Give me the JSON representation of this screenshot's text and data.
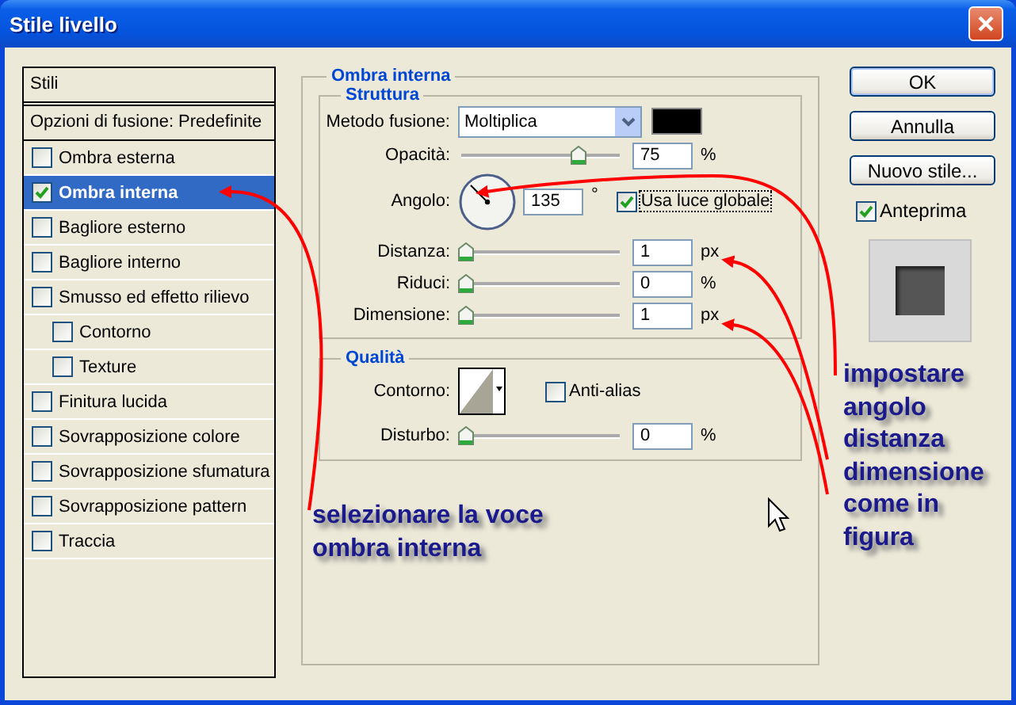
{
  "window": {
    "title": "Stile livello"
  },
  "styles_list": {
    "header": "Stili",
    "blend_options": "Opzioni di fusione: Predefinite",
    "items": [
      {
        "label": "Ombra esterna",
        "checked": false,
        "selected": false
      },
      {
        "label": "Ombra interna",
        "checked": true,
        "selected": true
      },
      {
        "label": "Bagliore esterno",
        "checked": false,
        "selected": false
      },
      {
        "label": "Bagliore interno",
        "checked": false,
        "selected": false
      },
      {
        "label": "Smusso ed effetto rilievo",
        "checked": false,
        "selected": false,
        "children": [
          {
            "label": "Contorno",
            "checked": false,
            "selected": false
          },
          {
            "label": "Texture",
            "checked": false,
            "selected": false
          }
        ]
      },
      {
        "label": "Finitura lucida",
        "checked": false,
        "selected": false
      },
      {
        "label": "Sovrapposizione colore",
        "checked": false,
        "selected": false
      },
      {
        "label": "Sovrapposizione sfumatura",
        "checked": false,
        "selected": false
      },
      {
        "label": "Sovrapposizione pattern",
        "checked": false,
        "selected": false
      },
      {
        "label": "Traccia",
        "checked": false,
        "selected": false
      }
    ]
  },
  "settings": {
    "title": "Ombra interna",
    "structure": {
      "title": "Struttura",
      "blend_mode": {
        "label": "Metodo fusione:",
        "value": "Moltiplica",
        "color": "#000000"
      },
      "opacity": {
        "label": "Opacità:",
        "level": 0.75,
        "value": "75",
        "unit": "%"
      },
      "angle": {
        "label": "Angolo:",
        "value": "135",
        "unit": "°",
        "global_light": {
          "label": "Usa luce globale",
          "checked": true
        }
      },
      "sliders": [
        {
          "label": "Distanza:",
          "level": 0,
          "value": "1",
          "unit": "px"
        },
        {
          "label": "Riduci:",
          "level": 0,
          "value": "0",
          "unit": "%"
        },
        {
          "label": "Dimensione:",
          "level": 0,
          "value": "1",
          "unit": "px"
        }
      ]
    },
    "quality": {
      "title": "Qualità",
      "contour": {
        "label": "Contorno:"
      },
      "anti_alias": {
        "label": "Anti-alias",
        "checked": false
      },
      "noise": {
        "label": "Disturbo:",
        "level": 0,
        "value": "0",
        "unit": "%"
      }
    }
  },
  "buttons": [
    {
      "label": "OK",
      "default": true
    },
    {
      "label": "Annulla",
      "default": false
    },
    {
      "label": "Nuovo stile...",
      "default": false
    }
  ],
  "preview": {
    "label": "Anteprima",
    "checked": true
  },
  "annotations": [
    {
      "text": "selezionare la voce ombra interna",
      "kind": "left"
    },
    {
      "text": "impostare angolo distanza dimensione come in figura",
      "kind": "right"
    }
  ]
}
